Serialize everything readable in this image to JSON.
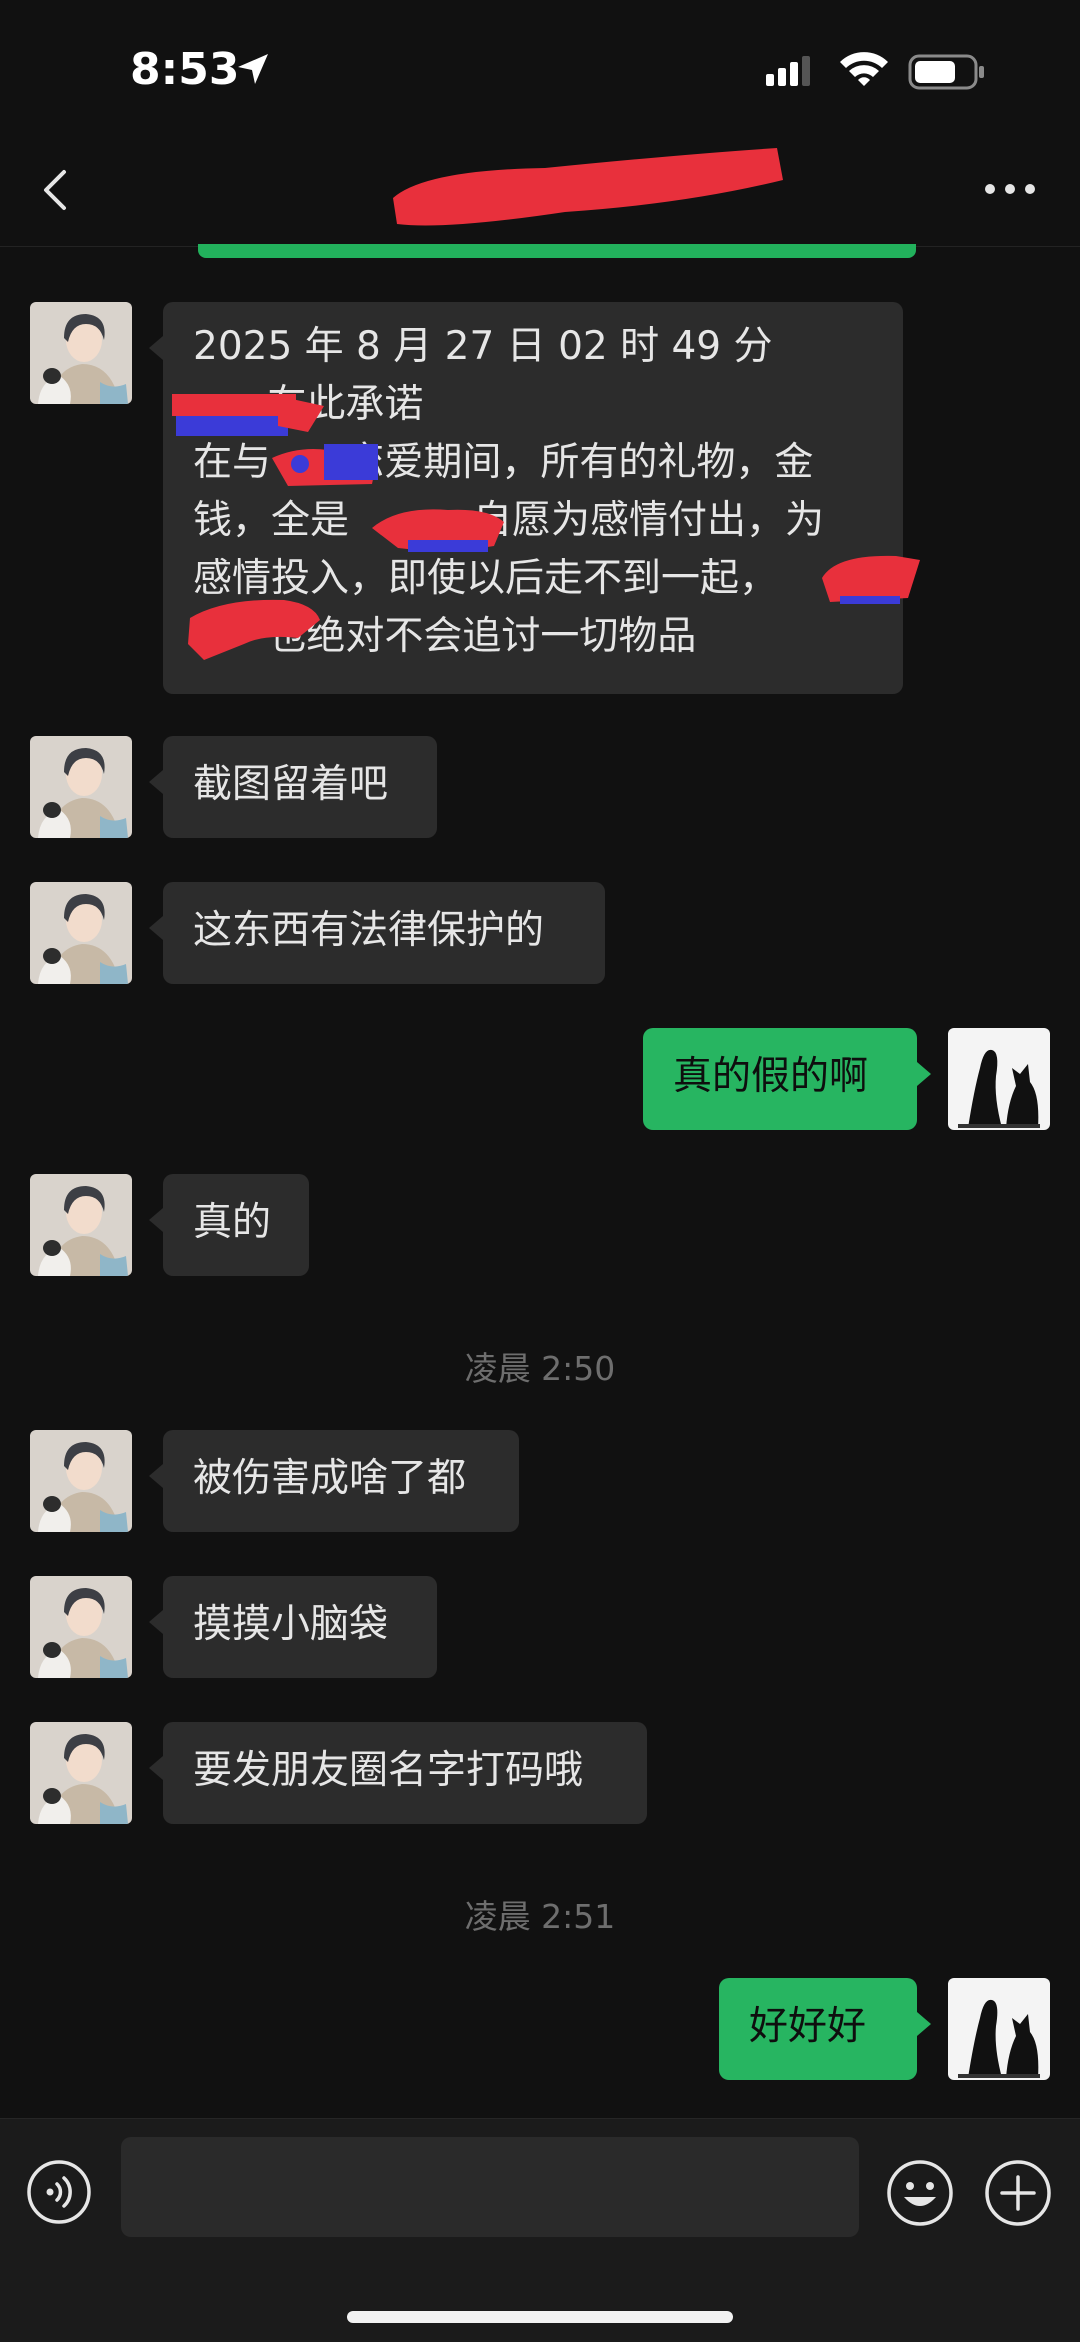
{
  "status_bar": {
    "time": "8:53"
  },
  "colors": {
    "incoming_bubble": "#2c2c2c",
    "outgoing_bubble": "#27b561",
    "background": "#111111",
    "redaction": "#e8303c"
  },
  "header": {
    "back_icon": "chevron-left-icon",
    "more_icon": "more-dots-icon"
  },
  "messages": [
    {
      "side": "left",
      "lines": [
        "2025 年 8 月 27 日 02 时 49 分",
        "      在此承诺",
        "在与      恋爱期间，所有的礼物，金",
        "钱，全是          自愿为感情付出，为",
        "感情投入，即使以后走不到一起，",
        "      也绝对不会追讨一切物品"
      ]
    },
    {
      "side": "left",
      "text": "截图留着吧"
    },
    {
      "side": "left",
      "text": "这东西有法律保护的"
    },
    {
      "side": "right",
      "text": "真的假的啊"
    },
    {
      "side": "left",
      "text": "真的"
    },
    {
      "side": "left",
      "text": "被伤害成啥了都"
    },
    {
      "side": "left",
      "text": "摸摸小脑袋"
    },
    {
      "side": "left",
      "text": "要发朋友圈名字打码哦"
    },
    {
      "side": "right",
      "text": "好好好"
    }
  ],
  "timestamps": [
    "凌晨 2:50",
    "凌晨 2:51"
  ],
  "input_bar": {
    "placeholder": "",
    "voice_icon": "voice-icon",
    "emoji_icon": "emoji-icon",
    "plus_icon": "plus-icon"
  }
}
